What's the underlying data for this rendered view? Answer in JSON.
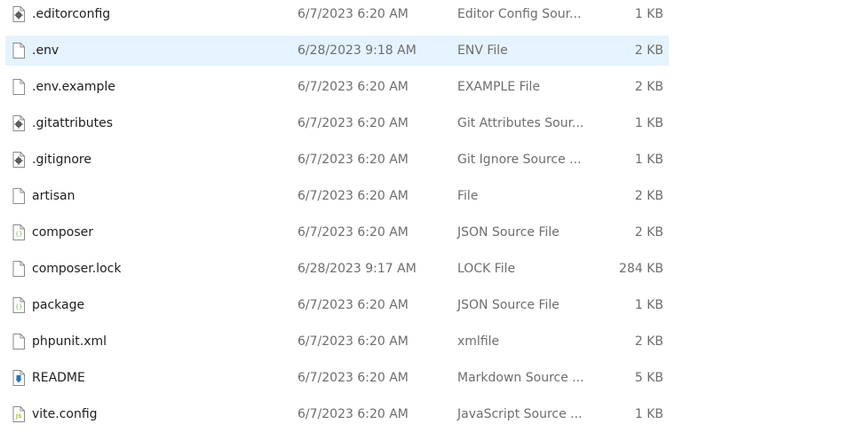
{
  "files": [
    {
      "name": ".editorconfig",
      "modified": "6/7/2023 6:20 AM",
      "type": "Editor Config Sour...",
      "size": "1 KB",
      "icon": "gear-file-icon"
    },
    {
      "name": ".env",
      "modified": "6/28/2023 9:18 AM",
      "type": "ENV File",
      "size": "2 KB",
      "icon": "blank-file-icon",
      "selected": true
    },
    {
      "name": ".env.example",
      "modified": "6/7/2023 6:20 AM",
      "type": "EXAMPLE File",
      "size": "2 KB",
      "icon": "blank-file-icon"
    },
    {
      "name": ".gitattributes",
      "modified": "6/7/2023 6:20 AM",
      "type": "Git Attributes Sour...",
      "size": "1 KB",
      "icon": "gear-file-icon"
    },
    {
      "name": ".gitignore",
      "modified": "6/7/2023 6:20 AM",
      "type": "Git Ignore Source ...",
      "size": "1 KB",
      "icon": "gear-file-icon"
    },
    {
      "name": "artisan",
      "modified": "6/7/2023 6:20 AM",
      "type": "File",
      "size": "2 KB",
      "icon": "blank-file-icon"
    },
    {
      "name": "composer",
      "modified": "6/7/2023 6:20 AM",
      "type": "JSON Source File",
      "size": "2 KB",
      "icon": "json-file-icon"
    },
    {
      "name": "composer.lock",
      "modified": "6/28/2023 9:17 AM",
      "type": "LOCK File",
      "size": "284 KB",
      "icon": "blank-file-icon"
    },
    {
      "name": "package",
      "modified": "6/7/2023 6:20 AM",
      "type": "JSON Source File",
      "size": "1 KB",
      "icon": "json-file-icon"
    },
    {
      "name": "phpunit.xml",
      "modified": "6/7/2023 6:20 AM",
      "type": "xmlfile",
      "size": "2 KB",
      "icon": "blank-file-icon"
    },
    {
      "name": "README",
      "modified": "6/7/2023 6:20 AM",
      "type": "Markdown Source ...",
      "size": "5 KB",
      "icon": "markdown-file-icon"
    },
    {
      "name": "vite.config",
      "modified": "6/7/2023 6:20 AM",
      "type": "JavaScript Source ...",
      "size": "1 KB",
      "icon": "js-file-icon"
    }
  ],
  "colors": {
    "selection_background": "#e5f3ff",
    "name_text": "#1e1e1e",
    "detail_text": "#6d6d6d",
    "json_icon": "#8bb24b",
    "js_icon": "#b5b93a",
    "markdown_icon": "#2d72b8"
  }
}
